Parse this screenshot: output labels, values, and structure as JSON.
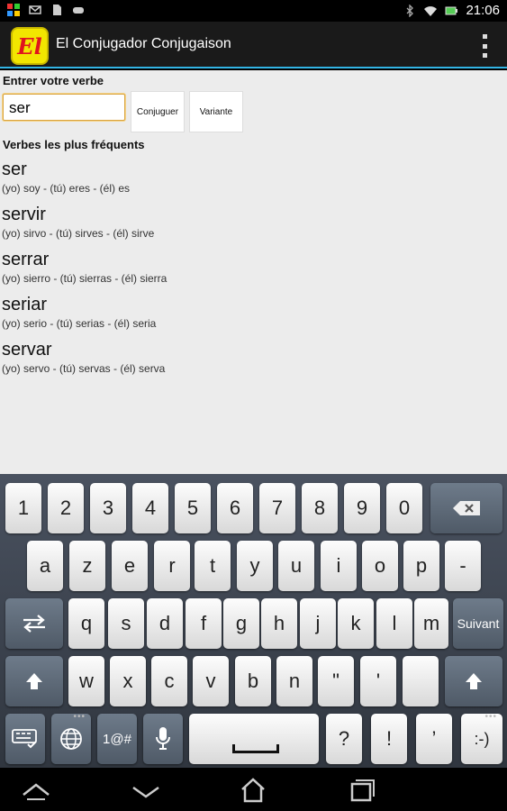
{
  "status_bar": {
    "time": "21:06"
  },
  "action_bar": {
    "logo_text": "El",
    "title": "El Conjugador Conjugaison"
  },
  "form": {
    "entry_label": "Entrer votre verbe",
    "verb_value": "ser",
    "conjugate_label": "Conjuguer",
    "variant_label": "Variante"
  },
  "frequent": {
    "heading": "Verbes les plus fréquents",
    "verbs": [
      {
        "name": "ser",
        "conj": "(yo) soy - (tú) eres - (él) es"
      },
      {
        "name": "servir",
        "conj": "(yo) sirvo - (tú) sirves - (él) sirve"
      },
      {
        "name": "serrar",
        "conj": "(yo) sierro - (tú) sierras - (él) sierra"
      },
      {
        "name": "seriar",
        "conj": "(yo) serio - (tú) serias - (él) seria"
      },
      {
        "name": "servar",
        "conj": "(yo) servo - (tú) servas - (él) serva"
      }
    ]
  },
  "keyboard": {
    "row1": [
      "1",
      "2",
      "3",
      "4",
      "5",
      "6",
      "7",
      "8",
      "9",
      "0"
    ],
    "row2": [
      "a",
      "z",
      "e",
      "r",
      "t",
      "y",
      "u",
      "i",
      "o",
      "p",
      "-"
    ],
    "row3": [
      "q",
      "s",
      "d",
      "f",
      "g",
      "h",
      "j",
      "k",
      "l",
      "m"
    ],
    "row3_action": "Suivant",
    "row4": [
      "w",
      "x",
      "c",
      "v",
      "b",
      "n",
      "\"",
      "'"
    ],
    "row5": {
      "symbols": "1@#",
      "question": "?",
      "exclaim": "!",
      "apostrophe": "’",
      "smiley": ":-)"
    }
  }
}
